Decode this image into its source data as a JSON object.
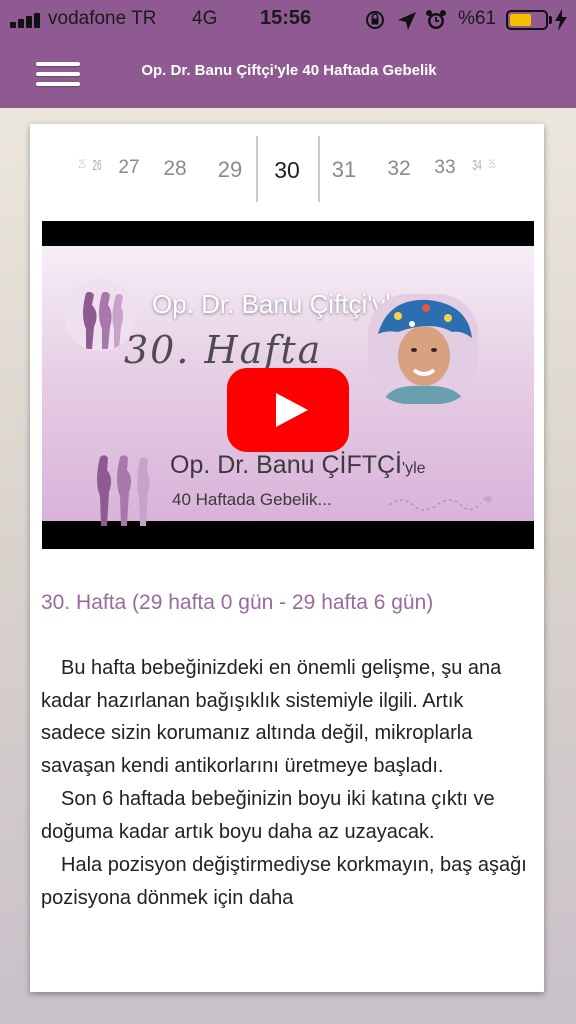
{
  "status_bar": {
    "carrier": "vodafone TR",
    "network": "4G",
    "time": "15:56",
    "battery": "%61",
    "battery_level": 0.61,
    "icons": [
      "orientation-lock-icon",
      "location-arrow-icon",
      "alarm-icon"
    ]
  },
  "header": {
    "title": "Op. Dr. Banu Çiftçi'yle 40 Haftada Gebelik",
    "menu_icon": "hamburger-menu-icon",
    "color": "#8e5a91"
  },
  "weeks": {
    "items": [
      "25",
      "26",
      "27",
      "28",
      "29",
      "30",
      "31",
      "32",
      "33",
      "34",
      "35"
    ],
    "selected": "30"
  },
  "video": {
    "title": "Op. Dr. Banu Çiftçi'yle 4...",
    "overlay_text": "30. Hafta",
    "brand_name": "Op. Dr. Banu ÇİFTÇİ",
    "brand_suffix": "'yle",
    "brand_subtitle": "40 Haftada Gebelik...",
    "play_icon": "youtube-play-icon"
  },
  "article": {
    "heading": "30. Hafta (29 hafta 0 gün - 29 hafta 6 gün)",
    "paragraphs": [
      "Bu hafta bebeğinizdeki en önemli gelişme, şu ana kadar hazırlanan bağışıklık sistemiyle ilgili. Artık sadece sizin korumanız altında değil, mikroplarla savaşan kendi antikorlarını üretmeye başladı.",
      "Son 6 haftada bebeğinizin boyu iki katına çıktı ve doğuma kadar artık boyu daha az uzayacak.",
      "Hala pozisyon değiştirmediyse korkmayın, baş aşağı pozisyona dönmek için daha"
    ]
  },
  "colors": {
    "accent": "#9b6a9d",
    "youtube_red": "#ff0000"
  }
}
